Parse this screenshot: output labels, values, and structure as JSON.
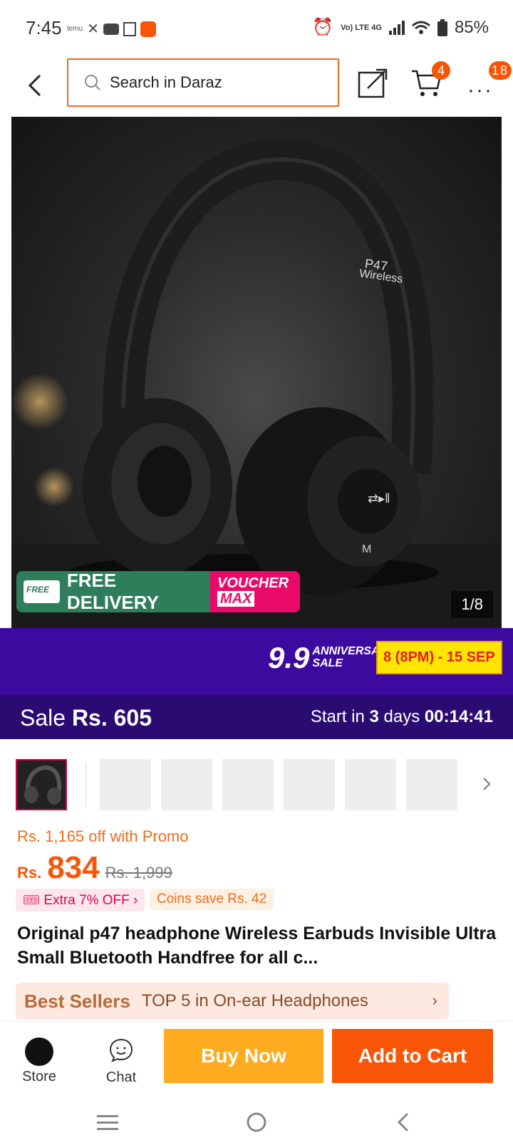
{
  "status": {
    "time": "7:45",
    "battery": "85%",
    "network": "Vo) LTE 4G"
  },
  "header": {
    "search_placeholder": "Search in Daraz",
    "cart_count": "4",
    "more_count": "18"
  },
  "hero": {
    "product_print": "P47",
    "product_print_sub": "Wireless",
    "free_delivery": "FREE DELIVERY",
    "free_small": "FREE",
    "voucher_line1": "VOUCHER",
    "voucher_line2": "MAX",
    "counter": "1/8"
  },
  "promo": {
    "big": "9.9",
    "anniv1": "ANNIVERSARY",
    "anniv2": "SALE",
    "dates": "8 (8PM) - 15 SEP"
  },
  "sale": {
    "label": "Sale",
    "price": "Rs. 605",
    "start_prefix": "Start in",
    "days": "3",
    "days_word": "days",
    "timer": "00:14:41"
  },
  "product": {
    "promo_off": "Rs. 1,165 off with Promo",
    "currency": "Rs.",
    "price": "834",
    "original": "Rs. 1,999",
    "extra_off": "Extra 7% OFF",
    "coins": "Coins save Rs. 42",
    "title": "Original p47 headphone Wireless Earbuds Invisible Ultra Small Bluetooth Handfree for all c...",
    "bestseller_brand": "Best Sellers",
    "bestseller_text": "TOP 5 in On-ear Headphones"
  },
  "actions": {
    "store": "Store",
    "chat": "Chat",
    "buy_now": "Buy Now",
    "add_to_cart": "Add to Cart"
  },
  "colors": {
    "brand": "#f85606",
    "promo_bg": "#3d0aa0",
    "buy_now": "#fdab1f"
  }
}
